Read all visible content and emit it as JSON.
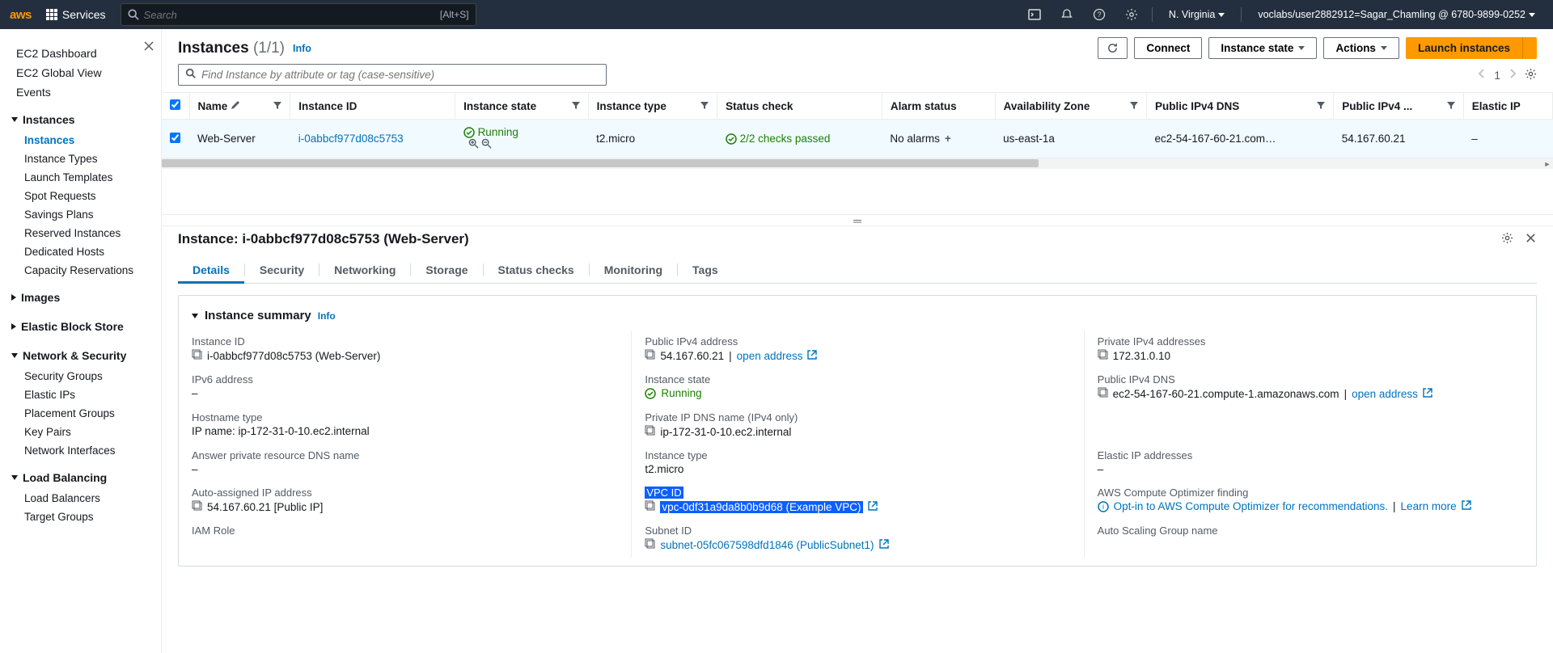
{
  "topnav": {
    "services": "Services",
    "search_placeholder": "Search",
    "search_shortcut": "[Alt+S]",
    "region": "N. Virginia",
    "user": "voclabs/user2882912=Sagar_Chamling @ 6780-9899-0252"
  },
  "sidebar": {
    "top": [
      "EC2 Dashboard",
      "EC2 Global View",
      "Events"
    ],
    "instances_head": "Instances",
    "instances": [
      "Instances",
      "Instance Types",
      "Launch Templates",
      "Spot Requests",
      "Savings Plans",
      "Reserved Instances",
      "Dedicated Hosts",
      "Capacity Reservations"
    ],
    "images_head": "Images",
    "ebs_head": "Elastic Block Store",
    "netsec_head": "Network & Security",
    "netsec": [
      "Security Groups",
      "Elastic IPs",
      "Placement Groups",
      "Key Pairs",
      "Network Interfaces"
    ],
    "lb_head": "Load Balancing",
    "lb": [
      "Load Balancers",
      "Target Groups"
    ]
  },
  "page": {
    "title": "Instances",
    "count": "(1/1)",
    "info": "Info",
    "find_placeholder": "Find Instance by attribute or tag (case-sensitive)",
    "actions": {
      "connect": "Connect",
      "instance_state": "Instance state",
      "actions": "Actions",
      "launch": "Launch instances"
    },
    "pager": "1"
  },
  "table": {
    "headers": [
      "Name",
      "Instance ID",
      "Instance state",
      "Instance type",
      "Status check",
      "Alarm status",
      "Availability Zone",
      "Public IPv4 DNS",
      "Public IPv4 ...",
      "Elastic IP"
    ],
    "row": {
      "name": "Web-Server",
      "instance_id": "i-0abbcf977d08c5753",
      "state": "Running",
      "type": "t2.micro",
      "status": "2/2 checks passed",
      "alarm": "No alarms",
      "az": "us-east-1a",
      "dns": "ec2-54-167-60-21.com…",
      "ip": "54.167.60.21",
      "eip": "–"
    }
  },
  "detail": {
    "title_prefix": "Instance: ",
    "title_id": "i-0abbcf977d08c5753 (Web-Server)",
    "tabs": [
      "Details",
      "Security",
      "Networking",
      "Storage",
      "Status checks",
      "Monitoring",
      "Tags"
    ],
    "summary_head": "Instance summary",
    "info": "Info",
    "fields": {
      "instance_id_l": "Instance ID",
      "instance_id_v": "i-0abbcf977d08c5753 (Web-Server)",
      "public_ip_l": "Public IPv4 address",
      "public_ip_v": "54.167.60.21",
      "open_addr": "open address",
      "private_ip_l": "Private IPv4 addresses",
      "private_ip_v": "172.31.0.10",
      "ipv6_l": "IPv6 address",
      "ipv6_v": "–",
      "state_l": "Instance state",
      "state_v": "Running",
      "public_dns_l": "Public IPv4 DNS",
      "public_dns_v": "ec2-54-167-60-21.compute-1.amazonaws.com",
      "hostname_l": "Hostname type",
      "hostname_v": "IP name: ip-172-31-0-10.ec2.internal",
      "privdns_l": "Private IP DNS name (IPv4 only)",
      "privdns_v": "ip-172-31-0-10.ec2.internal",
      "answer_l": "Answer private resource DNS name",
      "answer_v": "–",
      "type_l": "Instance type",
      "type_v": "t2.micro",
      "eip_l": "Elastic IP addresses",
      "eip_v": "–",
      "autoip_l": "Auto-assigned IP address",
      "autoip_v": "54.167.60.21 [Public IP]",
      "vpc_l": "VPC ID",
      "vpc_v": "vpc-0df31a9da8b0b9d68 (Example VPC)",
      "opt_l": "AWS Compute Optimizer finding",
      "opt_v": "Opt-in to AWS Compute Optimizer for recommendations.",
      "learn": "Learn more",
      "iam_l": "IAM Role",
      "subnet_l": "Subnet ID",
      "subnet_v": "subnet-05fc067598dfd1846 (PublicSubnet1)",
      "asg_l": "Auto Scaling Group name"
    }
  }
}
